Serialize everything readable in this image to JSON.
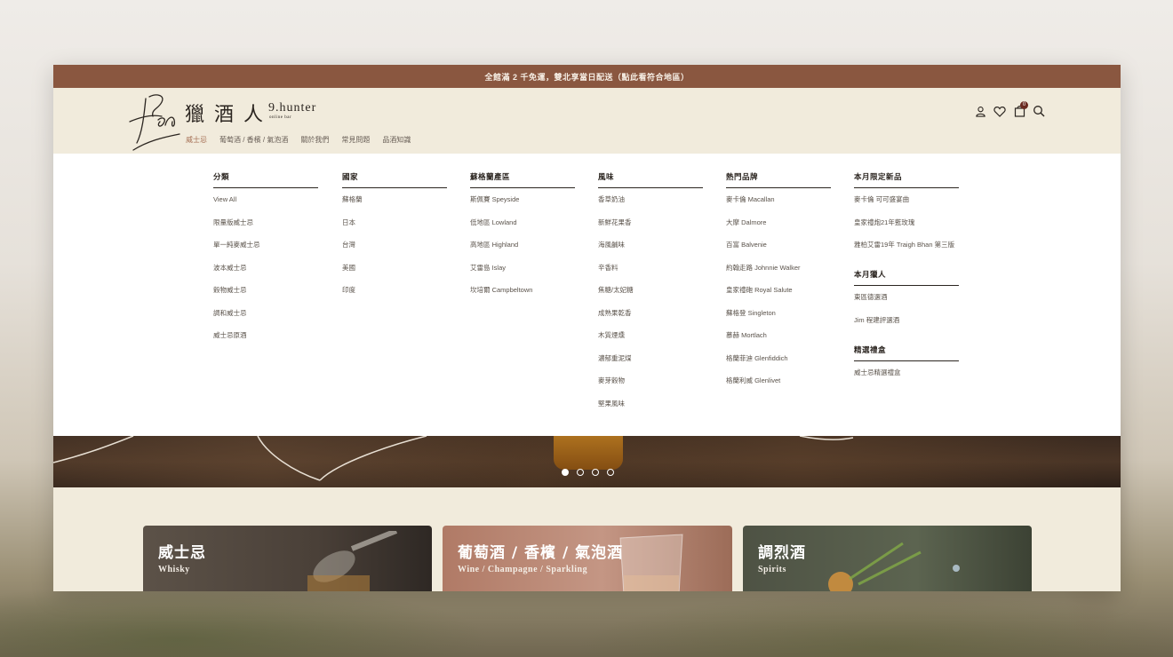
{
  "announcement": "全館滿 2 千免運，雙北享當日配送（點此看符合地區）",
  "logo": {
    "cn": "獵 酒 人",
    "en": "9.hunter",
    "sub": "online bar"
  },
  "nav": [
    "威士忌",
    "葡萄酒 / 香檳 / 氣泡酒",
    "關於我們",
    "常見問題",
    "品酒知識"
  ],
  "icons": {
    "account": "user-icon",
    "wishlist": "heart-icon",
    "cart": "bag-icon",
    "search": "search-icon",
    "cart_count": "0"
  },
  "mega": {
    "category": {
      "title": "分類",
      "items": [
        "View All",
        "限量版威士忌",
        "單一純麥威士忌",
        "波本威士忌",
        "穀物威士忌",
        "調和威士忌",
        "威士忌原酒"
      ]
    },
    "country": {
      "title": "國家",
      "items": [
        "蘇格蘭",
        "日本",
        "台灣",
        "美國",
        "印度"
      ]
    },
    "region": {
      "title": "蘇格蘭產區",
      "items": [
        "斯佩賽 Speyside",
        "低地區 Lowland",
        "高地區 Highland",
        "艾雷島 Islay",
        "坎培爾 Campbeltown"
      ]
    },
    "flavor": {
      "title": "風味",
      "items": [
        "香草奶油",
        "新鮮花果香",
        "海風鹹味",
        "辛香料",
        "焦糖/太妃糖",
        "成熟果乾香",
        "木質煙燻",
        "濃郁重泥煤",
        "麥芽穀物",
        "堅果風味"
      ]
    },
    "brands": {
      "title": "熱門品牌",
      "items": [
        "麥卡倫 Macallan",
        "大摩 Dalmore",
        "百富 Balvenie",
        "約翰走路 Johnnie Walker",
        "皇家禮砲 Royal Salute",
        "蘇格登 Singleton",
        "慕赫 Mortlach",
        "格蘭菲迪 Glenfiddich",
        "格蘭利威 Glenlivet"
      ]
    },
    "monthly": {
      "title": "本月限定新品",
      "items": [
        "麥卡倫 可可盛宴曲",
        "皇家禮炮21年藍玫瑰",
        "雅柏艾雷19年 Traigh Bhan 第三版"
      ]
    },
    "hunter": {
      "title": "本月獵人",
      "items": [
        "東區德選酒",
        "Jim 程建評選酒"
      ]
    },
    "gift": {
      "title": "精選禮盒",
      "items": [
        "威士忌精選禮盒"
      ]
    }
  },
  "carousel": {
    "slides": 4,
    "active": 1
  },
  "cards": [
    {
      "title": "威士忌",
      "subtitle": "Whisky"
    },
    {
      "title": "葡萄酒 / 香檳 / 氣泡酒",
      "subtitle": "Wine / Champagne / Sparkling"
    },
    {
      "title": "調烈酒",
      "subtitle": "Spirits"
    }
  ]
}
